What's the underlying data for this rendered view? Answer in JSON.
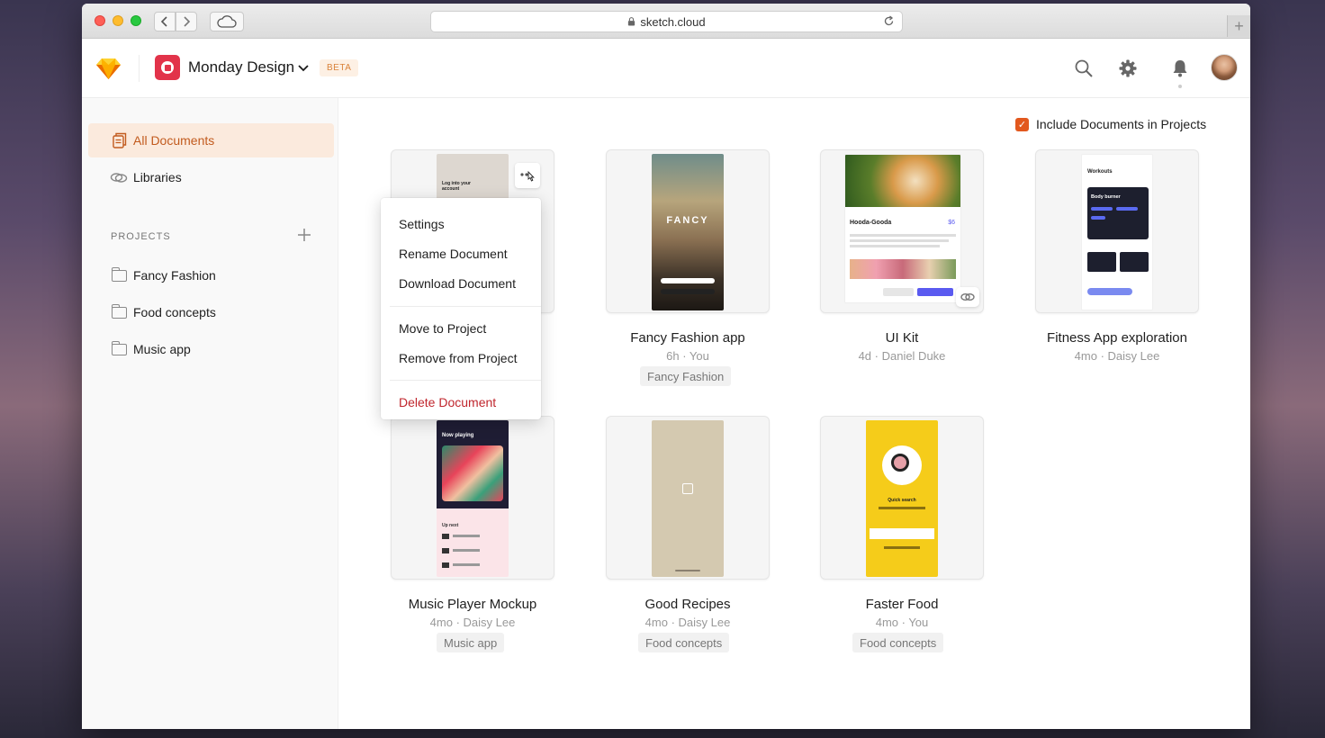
{
  "browser": {
    "url": "sketch.cloud",
    "icons": {
      "back": "chevron-left-icon",
      "forward": "chevron-right-icon",
      "cloud": "cloud-icon",
      "reload": "reload-icon",
      "new_tab": "plus-icon",
      "lock": "lock-icon"
    }
  },
  "header": {
    "workspace_name": "Monday Design",
    "beta_label": "BETA",
    "colors": {
      "workspace": "#e2334a",
      "accent": "#e2581e"
    }
  },
  "sidebar": {
    "items": [
      {
        "label": "All Documents",
        "icon": "documents-icon",
        "active": true
      },
      {
        "label": "Libraries",
        "icon": "libraries-icon",
        "active": false
      }
    ],
    "projects_label": "PROJECTS",
    "projects": [
      {
        "label": "Fancy Fashion",
        "icon": "folder-icon"
      },
      {
        "label": "Food concepts",
        "icon": "folder-icon"
      },
      {
        "label": "Music app",
        "icon": "folder-icon"
      }
    ]
  },
  "main": {
    "include_label": "Include Documents in Projects",
    "include_checked": true,
    "documents": [
      {
        "title": "",
        "meta": "",
        "tag": "",
        "preview_text": "Log into your account"
      },
      {
        "title": "Fancy Fashion app",
        "meta": "6h · You",
        "tag": "Fancy Fashion",
        "preview_text": "FANCY"
      },
      {
        "title": "UI Kit",
        "meta": "4d · Daniel Duke",
        "tag": "",
        "preview_text": "Hooda-Gooda",
        "preview_price": "$6"
      },
      {
        "title": "Fitness App exploration",
        "meta": "4mo · Daisy Lee",
        "tag": "",
        "preview_text": "Workouts",
        "preview_sub": "Body burner"
      },
      {
        "title": "Music Player Mockup",
        "meta": "4mo · Daisy Lee",
        "tag": "Music app",
        "preview_text": "Now playing",
        "preview_sub": "Up next"
      },
      {
        "title": "Good Recipes",
        "meta": "4mo · Daisy Lee",
        "tag": "Food concepts",
        "preview_text": ""
      },
      {
        "title": "Faster Food",
        "meta": "4mo · You",
        "tag": "Food concepts",
        "preview_text": "Quick search"
      }
    ]
  },
  "context_menu": {
    "items": [
      "Settings",
      "Rename Document",
      "Download Document",
      "Move to Project",
      "Remove from Project",
      "Delete Document"
    ]
  }
}
